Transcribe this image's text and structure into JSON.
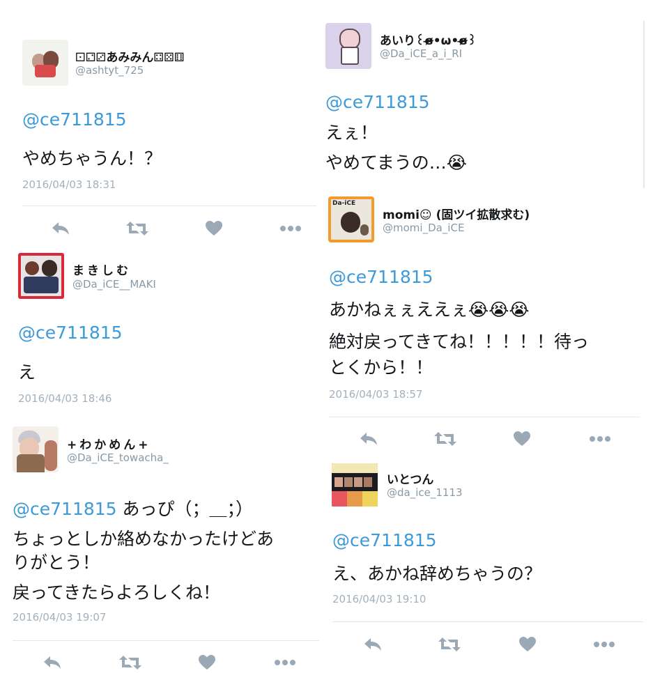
{
  "colors": {
    "mention": "#3d9ad8",
    "meta": "#a4b0ba",
    "icon": "#9aa9b5"
  },
  "tweets": [
    {
      "name": "⚀⚁⚂あみみん⚃⚄⚅",
      "handle": "@ashtyt_725",
      "lines": [
        "@ce711815",
        "やめちゃうん！？"
      ],
      "time": "2016/04/03 18:31"
    },
    {
      "name": "まきしむ",
      "handle": "@Da_iCE__MAKI",
      "lines": [
        "@ce711815",
        "え"
      ],
      "time": "2016/04/03 18:46"
    },
    {
      "name": "+わかめん+",
      "handle": "@Da_iCE_towacha_",
      "mention": "@ce711815",
      "lines": [
        " あっぴ（；＿；）",
        "ちょっとしか絡めなかったけどあ",
        "りがとう！",
        "戻ってきたらよろしくね！"
      ],
      "time": "2016/04/03 19:07"
    },
    {
      "name": "あいり꒰ɞ̴̶̷•ω•ɞ̴̶̷꒱",
      "handle": "@Da_iCE_a_i_RI",
      "lines": [
        "@ce711815",
        "えぇ！",
        "やめてまうの…😭"
      ]
    },
    {
      "name": "momi☺ (固ツイ拡散求む)",
      "handle": "@momi_Da_iCE",
      "lines": [
        "@ce711815",
        "あかねぇぇええぇ😭😭😭",
        "絶対戻ってきてね！！！！！待っ",
        "とくから！！"
      ],
      "time": "2016/04/03 18:57",
      "avatar_label": "Da-iCE"
    },
    {
      "name": "いとつん",
      "handle": "@da_ice_1113",
      "lines": [
        "@ce711815",
        "え、あかね辞めちゃうの？"
      ],
      "time": "2016/04/03 19:10"
    }
  ],
  "actions": {
    "icons": [
      "reply-icon",
      "retweet-icon",
      "like-icon",
      "more-icon"
    ]
  }
}
